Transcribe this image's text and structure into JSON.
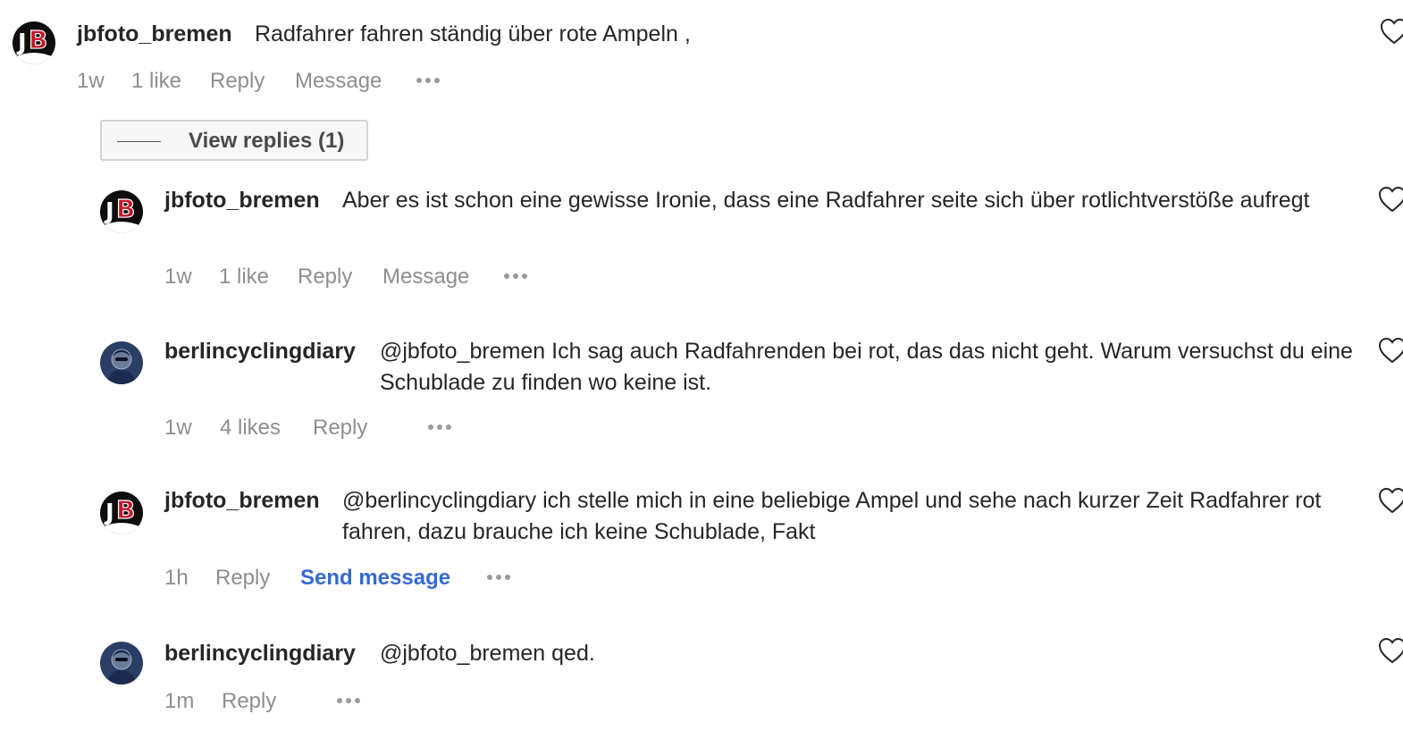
{
  "comments": [
    {
      "username": "jbfoto_bremen",
      "text": "Radfahrer fahren ständig über rote Ampeln ,",
      "time": "1w",
      "likes": "1 like",
      "reply": "Reply",
      "message": "Message",
      "avatar": "jb-logo"
    },
    {
      "username": "jbfoto_bremen",
      "text": "Aber es ist schon eine gewisse Ironie, dass eine Radfahrer seite sich über rotlichtverstöße aufregt",
      "time": "1w",
      "likes": "1 like",
      "reply": "Reply",
      "message": "Message",
      "avatar": "jb-logo"
    },
    {
      "username": "berlincyclingdiary",
      "text": "@jbfoto_bremen Ich sag auch Radfahrenden bei rot, das das nicht geht. Warum versuchst du eine Schublade zu finden wo keine ist.",
      "time": "1w",
      "likes": "4 likes",
      "reply": "Reply",
      "avatar": "cyclist-photo"
    },
    {
      "username": "jbfoto_bremen",
      "text": "@berlincyclingdiary ich stelle mich in eine beliebige Ampel und sehe nach kurzer Zeit Radfahrer rot fahren, dazu brauche ich keine Schublade, Fakt",
      "time": "1h",
      "reply": "Reply",
      "send_message": "Send message",
      "avatar": "jb-logo"
    },
    {
      "username": "berlincyclingdiary",
      "text": "@jbfoto_bremen qed.",
      "time": "1m",
      "reply": "Reply",
      "avatar": "cyclist-photo"
    }
  ],
  "view_replies": "View replies (1)",
  "icons": {
    "more": "more-options-icon",
    "like": "heart-icon"
  },
  "colors": {
    "text": "#262626",
    "meta": "#8e8e8e",
    "link": "#3569d1"
  }
}
